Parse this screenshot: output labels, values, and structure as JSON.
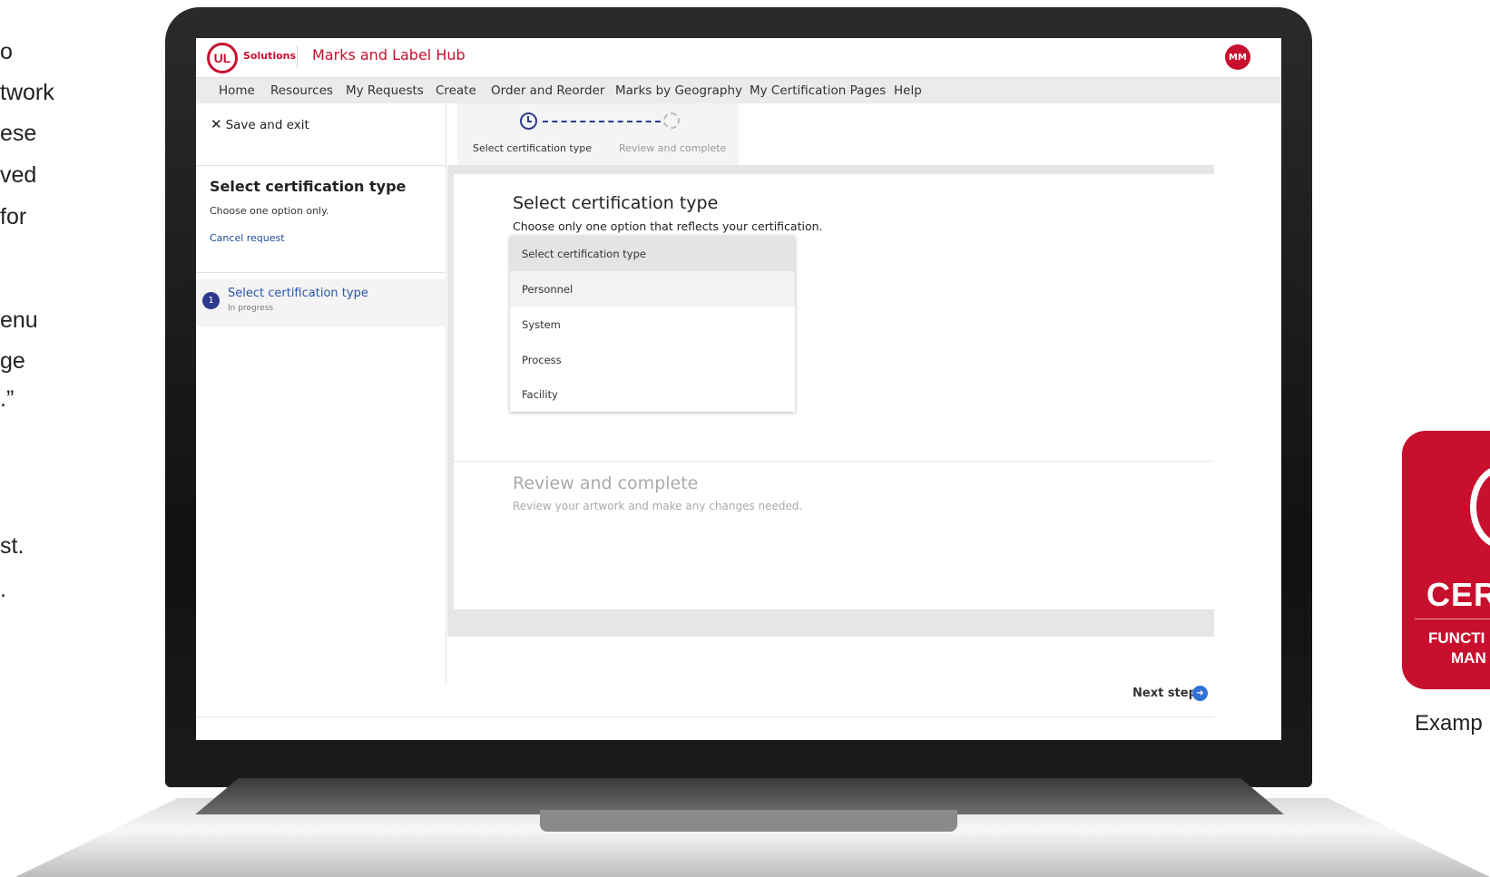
{
  "left_text_fragments": [
    "o",
    "twork",
    "ese",
    "ved",
    "for",
    "enu",
    "ge",
    ".”",
    "st.",
    "."
  ],
  "badge": {
    "title_fragment": "CER",
    "line1_fragment": "FUNCTI",
    "line2_fragment": "MAN",
    "caption_fragment": "Examp"
  },
  "app": {
    "brand_small": "Solutions",
    "title": "Marks and Label Hub",
    "avatar_initials": "MM",
    "brand_color": "#c8102e"
  },
  "nav": {
    "items": [
      "Home",
      "Resources",
      "My Requests",
      "Create",
      "Order and Reorder",
      "Marks by Geography",
      "My Certification Pages",
      "Help"
    ]
  },
  "sidebar": {
    "save_exit": "Save and exit",
    "heading": "Select certification type",
    "subtext": "Choose one option only.",
    "cancel": "Cancel request",
    "step": {
      "number": "1",
      "label": "Select certification type",
      "status": "In progress"
    }
  },
  "stepper": {
    "steps": [
      {
        "label": "Select certification type",
        "state": "current"
      },
      {
        "label": "Review and complete",
        "state": "pending"
      }
    ]
  },
  "main": {
    "section1": {
      "title": "Select certification type",
      "subtitle": "Choose only one option that reflects your certification."
    },
    "dropdown": {
      "placeholder": "Select certification type",
      "options": [
        "Personnel",
        "System",
        "Process",
        "Facility"
      ]
    },
    "section2": {
      "title": "Review and complete",
      "subtitle": "Review your artwork and make any changes needed."
    },
    "next_step": "Next step"
  }
}
